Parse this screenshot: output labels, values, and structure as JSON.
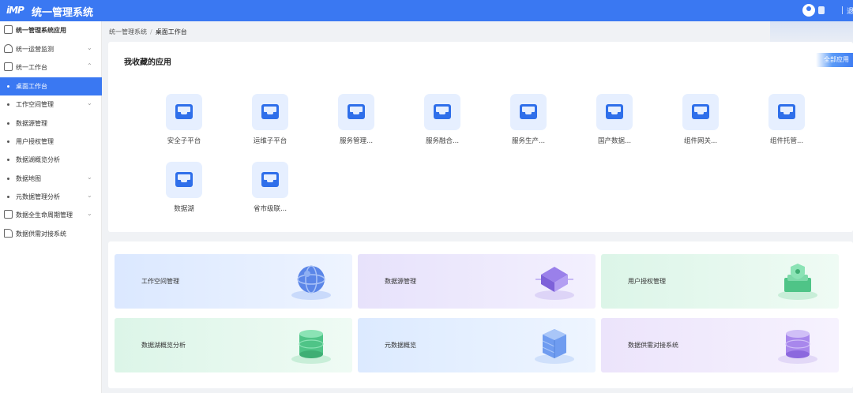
{
  "header": {
    "logo_text": "iMP",
    "title": "统一管理系统",
    "right_text": "退"
  },
  "sidebar": {
    "items": [
      {
        "label": "统一管理系统应用",
        "icon": "grid-icon",
        "type": "root"
      },
      {
        "label": "统一运营监测",
        "icon": "monitor-icon",
        "type": "group",
        "expanded": false
      },
      {
        "label": "统一工作台",
        "icon": "workbench-icon",
        "type": "group",
        "expanded": true
      },
      {
        "label": "桌面工作台",
        "type": "child",
        "active": true
      },
      {
        "label": "工作空间管理",
        "type": "child",
        "expandable": true
      },
      {
        "label": "数据源管理",
        "type": "child"
      },
      {
        "label": "用户授权管理",
        "type": "child"
      },
      {
        "label": "数据湖概览分析",
        "type": "child"
      },
      {
        "label": "数据地图",
        "type": "child",
        "expandable": true
      },
      {
        "label": "元数据管理分析",
        "type": "child",
        "expandable": true
      },
      {
        "label": "数据全生命周期管理",
        "icon": "lifecycle-icon",
        "type": "group",
        "expanded": false
      },
      {
        "label": "数据供需对接系统",
        "icon": "document-icon",
        "type": "root"
      }
    ]
  },
  "breadcrumb": {
    "parent": "统一管理系统",
    "separator": "/",
    "current": "桌面工作台"
  },
  "favorites": {
    "title": "我收藏的应用",
    "all_button": "全部应用",
    "apps": [
      {
        "name": "安全子平台",
        "icon": "inbox-icon"
      },
      {
        "name": "运维子平台",
        "icon": "inbox-icon"
      },
      {
        "name": "服务管理...",
        "icon": "inbox-icon"
      },
      {
        "name": "服务融合...",
        "icon": "inbox-icon"
      },
      {
        "name": "服务生产...",
        "icon": "inbox-icon"
      },
      {
        "name": "国产数据...",
        "icon": "inbox-icon"
      },
      {
        "name": "组件网关...",
        "icon": "inbox-icon"
      },
      {
        "name": "组件托管...",
        "icon": "inbox-icon"
      },
      {
        "name": "数据湖",
        "icon": "inbox-icon"
      },
      {
        "name": "省市级联...",
        "icon": "inbox-icon"
      }
    ]
  },
  "quick_cards": [
    {
      "label": "工作空间管理",
      "illustration": "globe-illustration",
      "theme": "#dbe8ff"
    },
    {
      "label": "数据源管理",
      "illustration": "pyramid-illustration",
      "theme": "#e7e2fb"
    },
    {
      "label": "用户授权管理",
      "illustration": "shield-box-illustration",
      "theme": "#dcf5e8"
    },
    {
      "label": "数据湖概览分析",
      "illustration": "database-cylinder-illustration",
      "theme": "#dcf5e8"
    },
    {
      "label": "元数据概览",
      "illustration": "server-stack-illustration",
      "theme": "#dceaff"
    },
    {
      "label": "数据供需对接系统",
      "illustration": "purple-cylinder-illustration",
      "theme": "#ece4fb"
    }
  ],
  "colors": {
    "primary": "#3a78f2",
    "icon_bg": "#e6efff"
  }
}
